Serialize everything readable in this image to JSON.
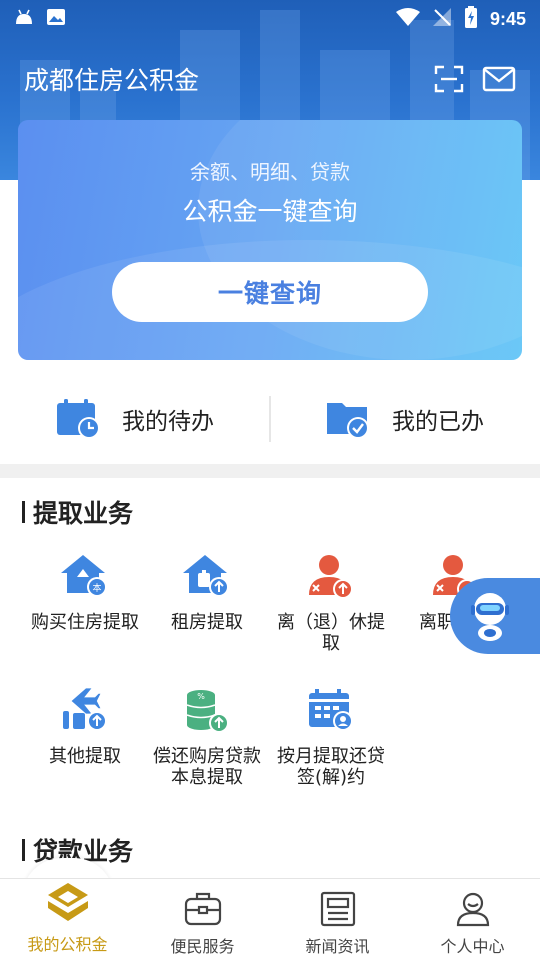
{
  "status_bar": {
    "time": "9:45"
  },
  "app_bar": {
    "title": "成都住房公积金",
    "scan_icon": "scan-icon",
    "mail_icon": "mail-icon"
  },
  "query_card": {
    "subtitle": "余额、明细、贷款",
    "title": "公积金一键查询",
    "button_label": "一键查询"
  },
  "todo": {
    "pending_label": "我的待办",
    "done_label": "我的已办"
  },
  "sections": {
    "withdraw": {
      "title": "提取业务",
      "items": [
        {
          "label": "购买住房提取",
          "icon": "house-buy-icon"
        },
        {
          "label": "租房提取",
          "icon": "house-rent-icon"
        },
        {
          "label": "离（退）休提取",
          "icon": "retire-icon"
        },
        {
          "label": "离职提取",
          "icon": "resign-icon"
        },
        {
          "label": "其他提取",
          "icon": "other-withdraw-icon"
        },
        {
          "label": "偿还购房贷款本息提取",
          "icon": "loan-repay-icon"
        },
        {
          "label": "按月提取还贷签(解)约",
          "icon": "monthly-calendar-icon"
        }
      ]
    },
    "loan": {
      "title": "贷款业务"
    }
  },
  "bottom_nav": {
    "items": [
      {
        "label": "我的公积金",
        "icon": "fund-logo-icon",
        "active": true
      },
      {
        "label": "便民服务",
        "icon": "toolbox-icon",
        "active": false
      },
      {
        "label": "新闻资讯",
        "icon": "news-icon",
        "active": false
      },
      {
        "label": "个人中心",
        "icon": "user-icon",
        "active": false
      }
    ]
  },
  "colors": {
    "header_blue": "#2a72cf",
    "accent_gold": "#c79a16",
    "icon_blue": "#3f86e0",
    "icon_red": "#e4593f"
  }
}
